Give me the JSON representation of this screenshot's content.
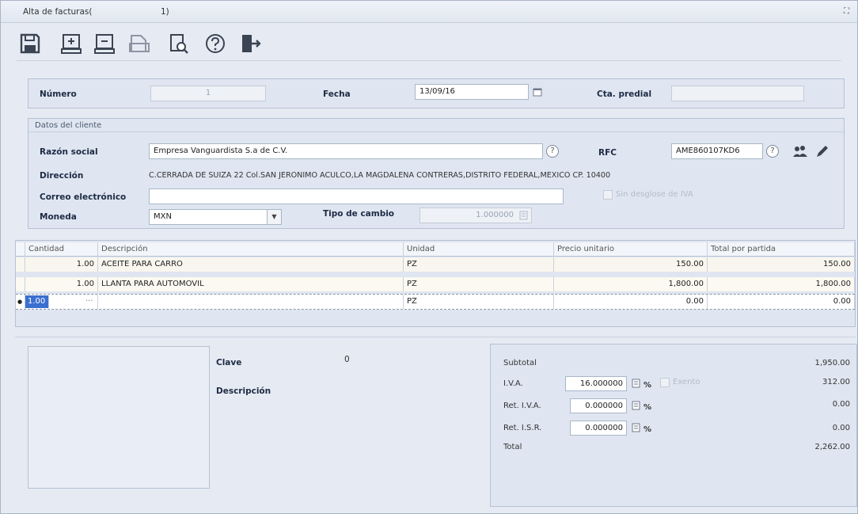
{
  "window": {
    "title": "Alta de facturas(",
    "title_suffix": "1)",
    "close_glyph": "⛶"
  },
  "toolbar": {
    "buttons": [
      {
        "name": "save-icon"
      },
      {
        "name": "add-row-icon"
      },
      {
        "name": "remove-row-icon"
      },
      {
        "name": "print-icon"
      },
      {
        "name": "preview-icon"
      },
      {
        "name": "help-icon"
      },
      {
        "name": "exit-icon"
      }
    ]
  },
  "header": {
    "numero_label": "Número",
    "numero_value": "1",
    "fecha_label": "Fecha",
    "fecha_value": "13/09/16",
    "cta_predial_label": "Cta. predial",
    "cta_predial_value": ""
  },
  "cliente": {
    "section_title": "Datos del cliente",
    "razon_social_label": "Razón social",
    "razon_social_value": "Empresa Vanguardista S.a de C.V.",
    "rfc_label": "RFC",
    "rfc_value": "AME860107KD6",
    "direccion_label": "Dirección",
    "direccion_value": "C.CERRADA DE SUIZA 22 Col.SAN JERONIMO ACULCO,LA MAGDALENA CONTRERAS,DISTRITO FEDERAL,MEXICO CP. 10400",
    "correo_label": "Correo electrónico",
    "correo_value": "",
    "sin_desglose_label": "Sin desglose de IVA",
    "moneda_label": "Moneda",
    "moneda_value": "MXN",
    "tipo_cambio_label": "Tipo de cambio",
    "tipo_cambio_value": "1.000000"
  },
  "grid": {
    "columns": [
      "Cantidad",
      "Descripción",
      "Unidad",
      "Precio unitario",
      "Total por partida"
    ],
    "rows": [
      {
        "cantidad": "1.00",
        "descripcion": "ACEITE PARA CARRO",
        "unidad": "PZ",
        "precio": "150.00",
        "total": "150.00"
      },
      {
        "cantidad": "1.00",
        "descripcion": "LLANTA PARA AUTOMOVIL",
        "unidad": "PZ",
        "precio": "1,800.00",
        "total": "1,800.00"
      }
    ],
    "new_row": {
      "cantidad": "1.00",
      "descripcion": "···",
      "unidad": "PZ",
      "precio": "0.00",
      "total": "0.00"
    },
    "row_marker": "●"
  },
  "producto": {
    "clave_label": "Clave",
    "clave_value": "0",
    "descripcion_label": "Descripción"
  },
  "totales": {
    "subtotal_label": "Subtotal",
    "subtotal_value": "1,950.00",
    "iva_label": "I.V.A.",
    "iva_rate": "16.000000",
    "iva_value": "312.00",
    "exento_label": "Exento",
    "ret_iva_label": "Ret. I.V.A.",
    "ret_iva_rate": "0.000000",
    "ret_iva_value": "0.00",
    "ret_isr_label": "Ret. I.S.R.",
    "ret_isr_rate": "0.000000",
    "ret_isr_value": "0.00",
    "total_label": "Total",
    "total_value": "2,262.00",
    "pct_symbol": "%"
  }
}
